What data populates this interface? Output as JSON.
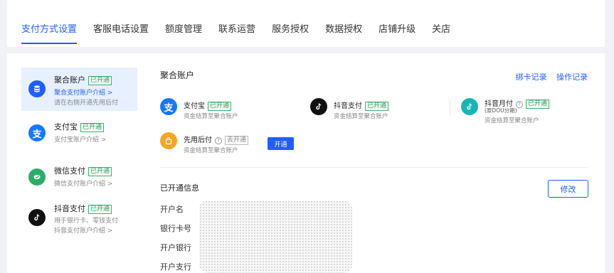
{
  "tabs": [
    "支付方式设置",
    "客服电话设置",
    "额度管理",
    "联系运营",
    "服务授权",
    "数据授权",
    "店铺升级",
    "关店"
  ],
  "active_tab_index": 0,
  "sidebar": {
    "items": [
      {
        "title": "聚合账户",
        "badge": "已开通",
        "sub1": "聚合支付账户介绍 >",
        "sub2": "请在右侧开通先用后付",
        "icon": "database-icon",
        "color": "#1f5fff"
      },
      {
        "title": "支付宝",
        "badge": "已开通",
        "sub1": "支付宝账户介绍 >",
        "icon": "alipay-icon",
        "color": "#1677ff"
      },
      {
        "title": "微信支付",
        "badge": "已开通",
        "sub1": "微信支付账户介绍 >",
        "icon": "wechat-pay-icon",
        "color": "#2aae67"
      },
      {
        "title": "抖音支付",
        "badge": "已开通",
        "sub1": "用于银行卡、零钱支付",
        "sub2": "抖音支付账户介绍 >",
        "icon": "douyin-icon",
        "color": "#111111"
      }
    ]
  },
  "main": {
    "title": "聚合账户",
    "links": [
      "绑卡记录",
      "操作记录"
    ],
    "payments": [
      {
        "name": "支付宝",
        "badge": "已开通",
        "desc": "资金结算至聚合账户",
        "icon": "alipay-icon",
        "color": "#1677ff"
      },
      {
        "name": "抖音支付",
        "badge": "已开通",
        "desc": "资金结算至聚合账户",
        "icon": "douyin-icon",
        "color": "#111111"
      },
      {
        "name": "抖音月付",
        "extra": "(原DOU分期)",
        "badge": "已开通",
        "desc": "资金结算至聚合账户",
        "icon": "douyin-monthly-icon",
        "color": "#19b5b5"
      },
      {
        "name": "先用后付",
        "badge": "去开通",
        "desc": "资金结算至聚合账户",
        "icon": "bag-icon",
        "color": "#f5a623"
      }
    ],
    "open_button": "开通",
    "info_title": "已开通信息",
    "edit_button": "修改",
    "fields": [
      "开户名",
      "银行卡号",
      "开户银行",
      "开户支行"
    ]
  }
}
